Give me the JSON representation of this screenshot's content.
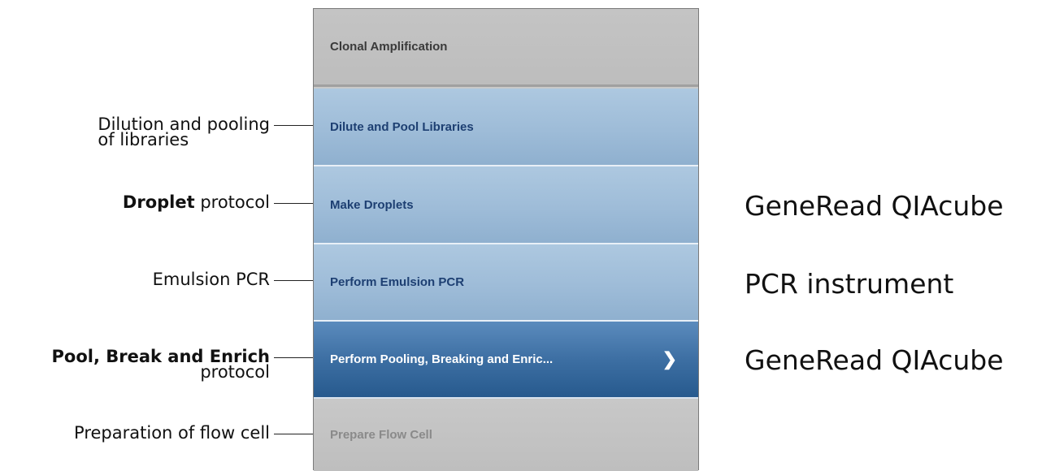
{
  "workflow": {
    "header": "Clonal Amplification",
    "steps": [
      {
        "label": "Dilute and Pool Libraries",
        "state": "todo"
      },
      {
        "label": "Make Droplets",
        "state": "todo"
      },
      {
        "label": "Perform Emulsion PCR",
        "state": "todo"
      },
      {
        "label": "Perform Pooling, Breaking and Enric...",
        "state": "active",
        "icon": "chevron-right-icon"
      },
      {
        "label": "Prepare Flow Cell",
        "state": "disabled"
      }
    ]
  },
  "annotations": {
    "dilute": {
      "line1": "Dilution and pooling",
      "line2": "of  libraries"
    },
    "droplet": {
      "bold": "Droplet",
      "rest": " protocol"
    },
    "emulsion": {
      "text": "Emulsion PCR"
    },
    "pool": {
      "bold": "Pool, Break and Enrich",
      "line2": "protocol"
    },
    "flow": {
      "text": "Preparation of flow cell"
    }
  },
  "instruments": {
    "droplets": "GeneRead QIAcube",
    "emulsion": "PCR instrument",
    "pooling": "GeneRead QIAcube"
  },
  "colors": {
    "step_todo": "#9ebcd8",
    "step_active": "#3d6fa3",
    "step_disabled": "#c4c4c4",
    "header": "#c0c0c0"
  }
}
